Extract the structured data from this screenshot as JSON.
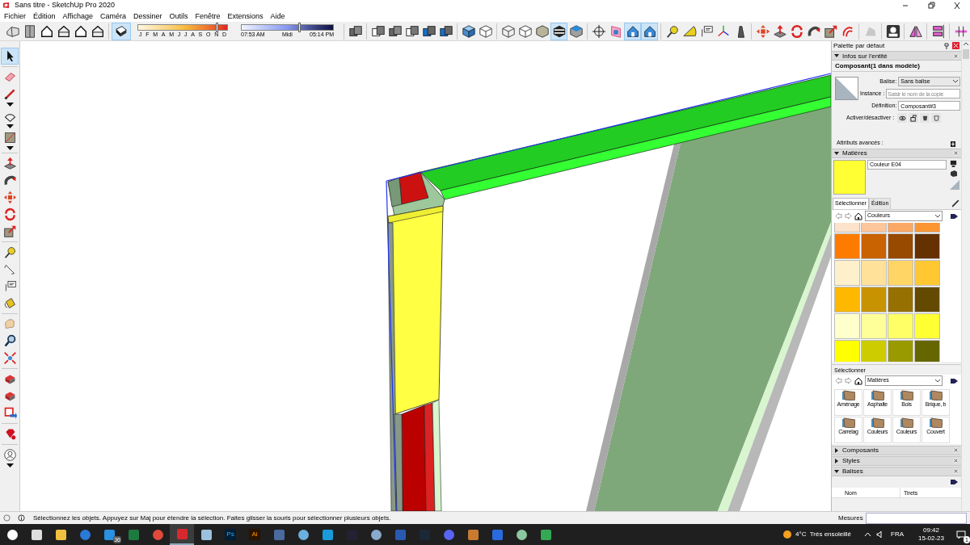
{
  "window": {
    "title": "Sans titre - SketchUp Pro 2020"
  },
  "menu": [
    "Fichier",
    "Édition",
    "Affichage",
    "Caméra",
    "Dessiner",
    "Outils",
    "Fenêtre",
    "Extensions",
    "Aide"
  ],
  "view_buttons": [
    {
      "selected": false
    },
    {
      "selected": false
    },
    {
      "selected": false
    },
    {
      "selected": false
    },
    {
      "selected": false
    },
    {
      "selected": false
    }
  ],
  "shadow_button": {
    "selected": true
  },
  "shadow_settings": {
    "months": [
      "J",
      "F",
      "M",
      "A",
      "M",
      "J",
      "J",
      "A",
      "S",
      "O",
      "N",
      "D"
    ],
    "month_slider": {
      "level": 0.89
    },
    "time_start": "07:53 AM",
    "time_mid": "Midi",
    "time_end": "05:14 PM",
    "time_slider": {
      "level": 0.63
    }
  },
  "tool_buttons": [
    {
      "selected": false
    },
    {
      "selected": false
    },
    {
      "selected": false
    },
    {
      "selected": false
    },
    {
      "selected": false
    },
    {
      "selected": false
    },
    {
      "selected": false
    },
    {
      "selected": false
    },
    {
      "selected": false
    },
    {
      "selected": false
    },
    {
      "selected": false
    },
    {
      "selected": true
    },
    {
      "selected": false
    },
    {
      "selected": false
    },
    {
      "selected": false
    },
    {
      "selected": true
    },
    {
      "selected": true
    },
    {
      "selected": false
    },
    {
      "selected": false
    },
    {
      "selected": false
    },
    {
      "selected": false
    },
    {
      "selected": false
    },
    {
      "selected": false
    },
    {
      "selected": false
    },
    {
      "selected": false
    },
    {
      "selected": false
    },
    {
      "selected": false
    },
    {
      "selected": false
    },
    {
      "selected": false
    },
    {
      "selected": false
    },
    {
      "selected": false
    },
    {
      "selected": false
    },
    {
      "selected": false
    }
  ],
  "left_toolbar": [
    {
      "selected": true
    },
    {
      "selected": false
    },
    {
      "selected": false
    },
    {
      "selected": false
    },
    {
      "selected": false
    },
    {
      "selected": false
    },
    {
      "selected": false
    },
    {
      "selected": false
    },
    {
      "selected": false
    },
    {
      "selected": false
    },
    {
      "selected": false
    },
    {
      "selected": false
    },
    {
      "selected": false
    },
    {
      "selected": false
    },
    {
      "selected": false
    },
    {
      "selected": false
    },
    {
      "selected": false
    },
    {
      "selected": false
    },
    {
      "selected": false
    },
    {
      "selected": false
    },
    {
      "selected": false
    },
    {
      "selected": false
    }
  ],
  "tray": {
    "title": "Palette par défaut"
  },
  "entity_info": {
    "title": "Infos sur l'entité",
    "expanded": true,
    "heading": "Composant(1 dans modèle)",
    "tag_label": "Balise:",
    "tag_value": "Sans balise",
    "instance_label": "Instance :",
    "instance_placeholder": "Saisir le nom de la copie",
    "definition_label": "Définition:",
    "definition_value": "Composant#3",
    "toggle_label": "Activer/désactiver :",
    "advanced_label": "Attributs avancés :"
  },
  "materials": {
    "title": "Matières",
    "expanded": true,
    "current_name": "Couleur E04",
    "tabs": [
      {
        "label": "Sélectionner",
        "selected": true
      },
      {
        "label": "Édition",
        "selected": false
      }
    ],
    "library": "Couleurs",
    "swatches": [
      {
        "color": "#fde3cc"
      },
      {
        "color": "#fcc59a"
      },
      {
        "color": "#fca865"
      },
      {
        "color": "#fb9532"
      },
      {
        "color": "#fd7c00"
      },
      {
        "color": "#c96200"
      },
      {
        "color": "#974a00"
      },
      {
        "color": "#653100"
      },
      {
        "color": "#fff0cc"
      },
      {
        "color": "#ffe199"
      },
      {
        "color": "#ffd566"
      },
      {
        "color": "#ffc833"
      },
      {
        "color": "#ffb800"
      },
      {
        "color": "#c79300"
      },
      {
        "color": "#967000"
      },
      {
        "color": "#644a00"
      },
      {
        "color": "#ffffcc"
      },
      {
        "color": "#ffff99"
      },
      {
        "color": "#ffff66"
      },
      {
        "color": "#ffff33"
      },
      {
        "color": "#ffff00"
      },
      {
        "color": "#cccc00"
      },
      {
        "color": "#999900"
      },
      {
        "color": "#666600"
      }
    ],
    "second_label": "Sélectionner",
    "second_library": "Matières",
    "folders": [
      "Aménage",
      "Asphalte",
      "Bois",
      "Brique, b",
      "Carrelag",
      "Couleurs",
      "Couleurs",
      "Couvert"
    ]
  },
  "collapsed_panels": [
    {
      "title": "Composants",
      "expanded": false
    },
    {
      "title": "Styles",
      "expanded": false
    },
    {
      "title": "Balises",
      "expanded": true
    }
  ],
  "tags_table": {
    "columns": [
      "Nom",
      "Tirets"
    ]
  },
  "status_bar": {
    "message": "Sélectionnez les objets. Appuyez sur Maj pour étendre la sélection. Faites glisser la souris pour sélectionner plusieurs objets.",
    "measure_label": "Mesures"
  },
  "taskbar": {
    "apps": [
      {
        "active": false
      },
      {
        "active": false
      },
      {
        "active": false
      },
      {
        "active": false
      },
      {
        "active": false,
        "badge": "36"
      },
      {
        "active": false
      },
      {
        "active": false
      },
      {
        "active": true
      },
      {
        "active": false
      },
      {
        "active": false,
        "label": "Ps"
      },
      {
        "active": false,
        "label": "Ai"
      },
      {
        "active": false
      },
      {
        "active": false
      },
      {
        "active": false
      },
      {
        "active": false
      },
      {
        "active": false
      },
      {
        "active": false
      },
      {
        "active": false
      },
      {
        "active": false
      },
      {
        "active": false
      },
      {
        "active": false
      },
      {
        "active": false
      },
      {
        "active": false
      }
    ],
    "weather": "4°C  Très ensoleillé",
    "language": "FRA",
    "time": "09:42",
    "date": "15-02-23",
    "notifications": "1"
  }
}
